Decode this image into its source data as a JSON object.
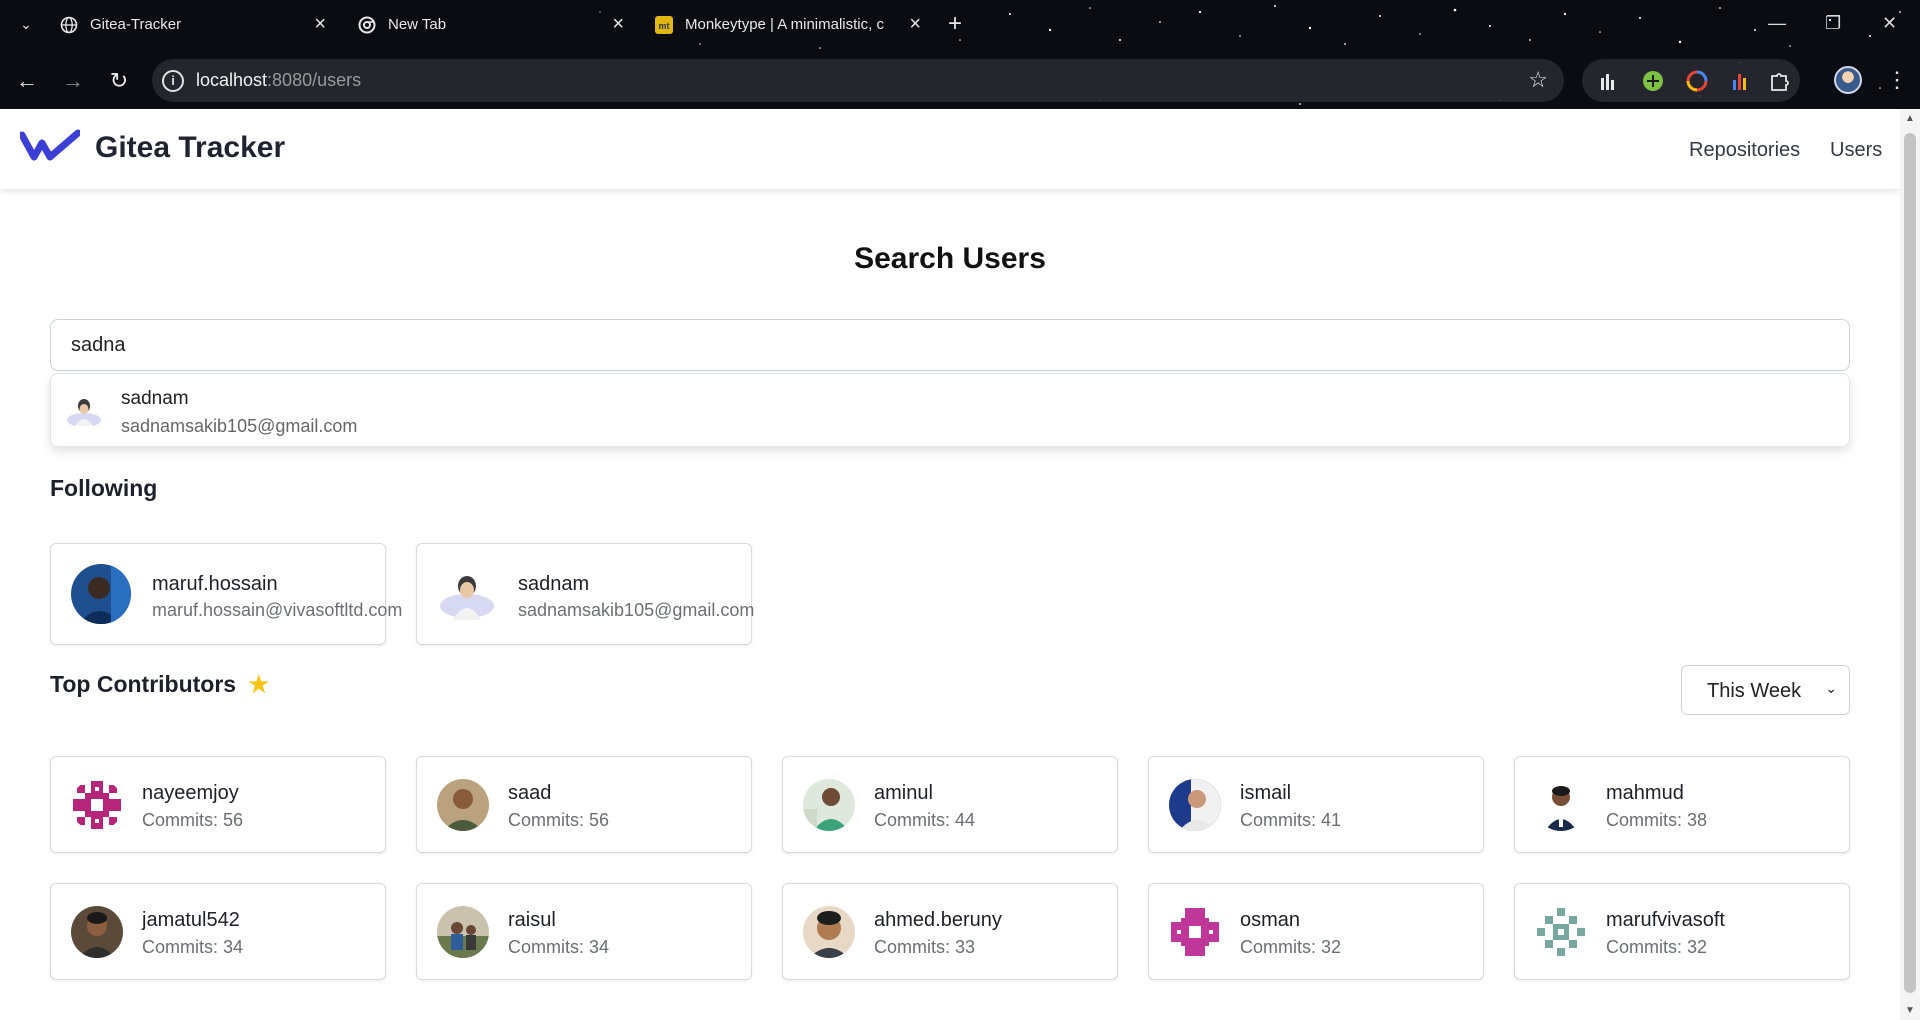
{
  "browser": {
    "tabs": [
      {
        "title": "Gitea-Tracker",
        "favicon": "globe-icon"
      },
      {
        "title": "New Tab",
        "favicon": "chrome-icon"
      },
      {
        "title": "Monkeytype | A minimalistic, cu",
        "favicon": "monkeytype-icon"
      }
    ],
    "url_host": "localhost",
    "url_path": ":8080/users"
  },
  "app": {
    "brand": "Gitea Tracker",
    "nav": [
      "Repositories",
      "Users"
    ]
  },
  "search": {
    "heading": "Search Users",
    "value": "sadna",
    "results": [
      {
        "name": "sadnam",
        "email": "sadnamsakib105@gmail.com"
      }
    ]
  },
  "following": {
    "title": "Following",
    "users": [
      {
        "name": "maruf.hossain",
        "email": "maruf.hossain@vivasoftltd.com"
      },
      {
        "name": "sadnam",
        "email": "sadnamsakib105@gmail.com"
      }
    ]
  },
  "contributors": {
    "title": "Top Contributors",
    "period": "This Week",
    "list": [
      {
        "name": "nayeemjoy",
        "commits": "Commits: 56"
      },
      {
        "name": "saad",
        "commits": "Commits: 56"
      },
      {
        "name": "aminul",
        "commits": "Commits: 44"
      },
      {
        "name": "ismail",
        "commits": "Commits: 41"
      },
      {
        "name": "mahmud",
        "commits": "Commits: 38"
      },
      {
        "name": "jamatul542",
        "commits": "Commits: 34"
      },
      {
        "name": "raisul",
        "commits": "Commits: 34"
      },
      {
        "name": "ahmed.beruny",
        "commits": "Commits: 33"
      },
      {
        "name": "osman",
        "commits": "Commits: 32"
      },
      {
        "name": "marufvivasoft",
        "commits": "Commits: 32"
      }
    ]
  },
  "colors": {
    "brand_logo": "#3b3fd6",
    "star": "#f5c518"
  }
}
